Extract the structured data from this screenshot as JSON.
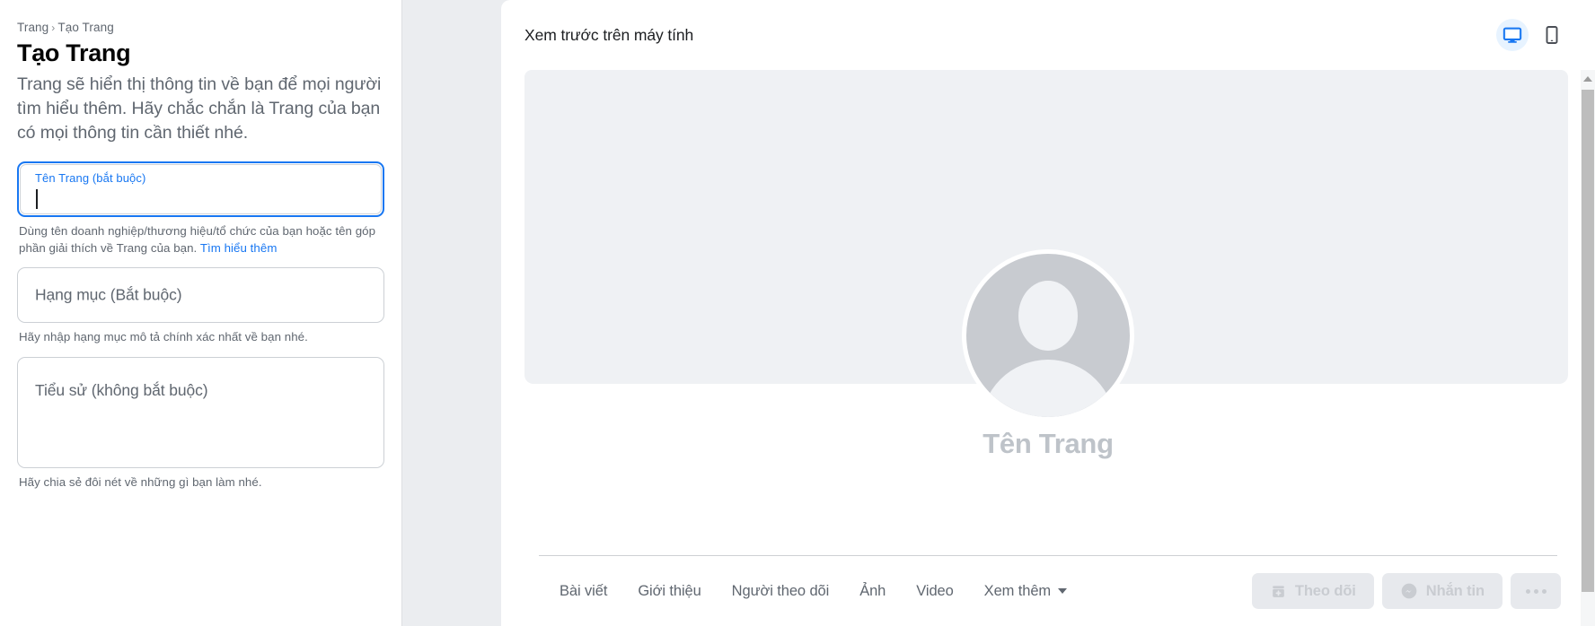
{
  "sidebar": {
    "breadcrumb": {
      "root": "Trang",
      "separator": "›",
      "current": "Tạo Trang"
    },
    "title": "Tạo Trang",
    "description": "Trang sẽ hiển thị thông tin về bạn để mọi người tìm hiểu thêm. Hãy chắc chắn là Trang của bạn có mọi thông tin cần thiết nhé.",
    "fields": {
      "name": {
        "label": "Tên Trang (bắt buộc)",
        "value": "",
        "focused": true,
        "helper_before": "Dùng tên doanh nghiệp/thương hiệu/tổ chức của bạn hoặc tên góp phần giải thích về Trang của bạn.",
        "helper_link": "Tìm hiểu thêm"
      },
      "category": {
        "placeholder": "Hạng mục (Bắt buộc)",
        "value": "",
        "helper": "Hãy nhập hạng mục mô tả chính xác nhất về bạn nhé."
      },
      "bio": {
        "placeholder": "Tiểu sử (không bắt buộc)",
        "value": "",
        "helper": "Hãy chia sẻ đôi nét về những gì bạn làm nhé."
      }
    }
  },
  "preview": {
    "heading": "Xem trước trên máy tính",
    "devices": [
      {
        "name": "desktop",
        "icon": "monitor-icon",
        "active": true
      },
      {
        "name": "mobile",
        "icon": "phone-icon",
        "active": false
      }
    ],
    "page_name_placeholder": "Tên Trang",
    "tabs": [
      {
        "label": "Bài viết"
      },
      {
        "label": "Giới thiệu"
      },
      {
        "label": "Người theo dõi"
      },
      {
        "label": "Ảnh"
      },
      {
        "label": "Video"
      },
      {
        "label": "Xem thêm",
        "has_chevron": true
      }
    ],
    "actions": [
      {
        "label": "Theo dõi",
        "icon": "follow-plus-icon",
        "disabled": true
      },
      {
        "label": "Nhắn tin",
        "icon": "messenger-icon",
        "disabled": true
      },
      {
        "label": "",
        "icon": "more-dots-icon",
        "disabled": true
      }
    ]
  },
  "colors": {
    "accent": "#1877f2",
    "page_bg": "#ebedf0",
    "card_bg": "#ffffff",
    "cover_bg": "#eff1f4",
    "text_primary": "#1c1e21",
    "text_secondary": "#606770",
    "placeholder_gray": "#bec3c9",
    "disabled_btn_bg": "#e7e9ed"
  }
}
